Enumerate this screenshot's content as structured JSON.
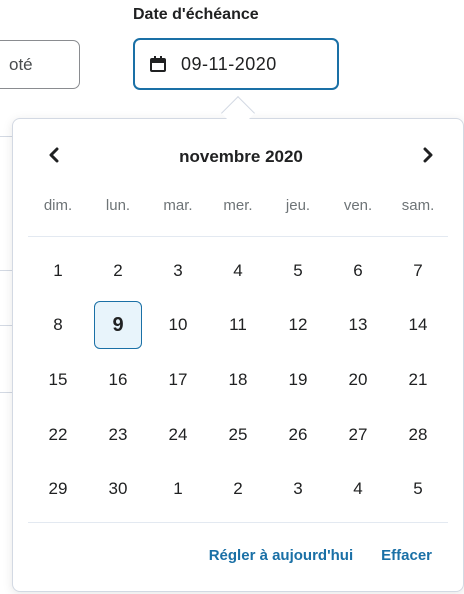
{
  "form": {
    "left_field_value": "oté",
    "due_date_label": "Date d'échéance",
    "due_date_value": "09-11-2020"
  },
  "calendar": {
    "month_title": "novembre 2020",
    "prev_icon": "chevron-left-icon",
    "next_icon": "chevron-right-icon",
    "weekdays": [
      "dim.",
      "lun.",
      "mar.",
      "mer.",
      "jeu.",
      "ven.",
      "sam."
    ],
    "weeks": [
      [
        "1",
        "2",
        "3",
        "4",
        "5",
        "6",
        "7"
      ],
      [
        "8",
        "9",
        "10",
        "11",
        "12",
        "13",
        "14"
      ],
      [
        "15",
        "16",
        "17",
        "18",
        "19",
        "20",
        "21"
      ],
      [
        "22",
        "23",
        "24",
        "25",
        "26",
        "27",
        "28"
      ],
      [
        "29",
        "30",
        "1",
        "2",
        "3",
        "4",
        "5"
      ]
    ],
    "selected_day": "9",
    "today_label": "Régler à aujourd'hui",
    "clear_label": "Effacer"
  },
  "colors": {
    "accent": "#1a70a6",
    "selected_bg": "#e8f4fb",
    "text": "#202122",
    "muted": "#6e7477"
  }
}
